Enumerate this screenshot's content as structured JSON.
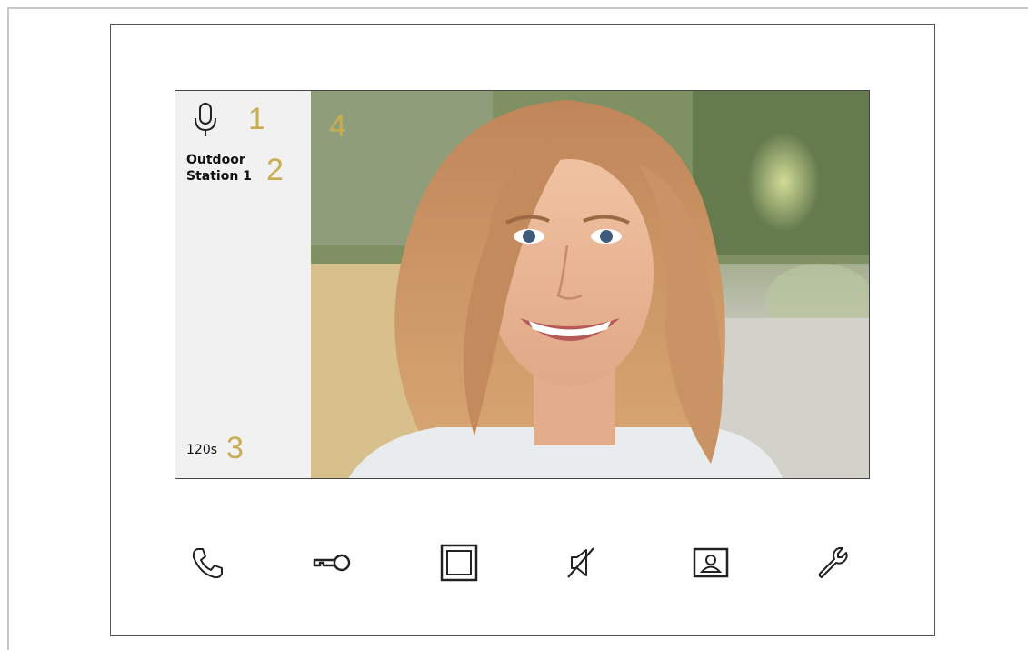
{
  "screen": {
    "mic_icon": "microphone-icon",
    "caller_name_line1": "Outdoor",
    "caller_name_line2": "Station 1",
    "talk_timer": "120s"
  },
  "callouts": [
    "1",
    "2",
    "3",
    "4"
  ],
  "callout_color": "#c8ad52",
  "video_feed": {
    "content": "live camera image of a smiling woman with long strawberry-blonde hair"
  },
  "controls": [
    {
      "icon": "phone-handset-icon"
    },
    {
      "icon": "key-icon"
    },
    {
      "icon": "screen-frame-icon"
    },
    {
      "icon": "mute-speaker-icon"
    },
    {
      "icon": "contact-card-icon"
    },
    {
      "icon": "wrench-icon"
    }
  ]
}
